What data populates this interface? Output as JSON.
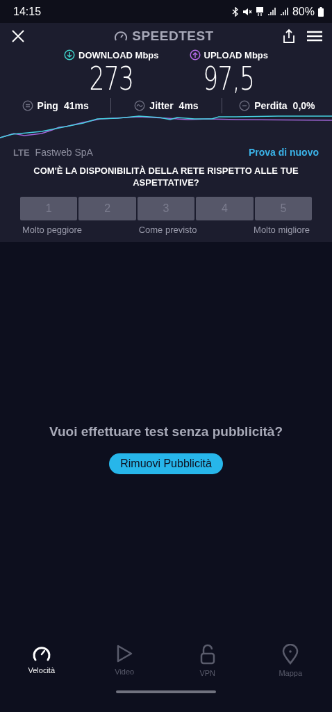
{
  "status_bar": {
    "time": "14:15",
    "battery": "80%"
  },
  "header": {
    "title": "SPEEDTEST"
  },
  "results": [
    {
      "kind": "download",
      "label": "DOWNLOAD Mbps",
      "value": "273"
    },
    {
      "kind": "upload",
      "label": "UPLOAD Mbps",
      "value": "97,5"
    }
  ],
  "metrics": [
    {
      "kind": "ping",
      "label": "Ping",
      "value": "41ms"
    },
    {
      "kind": "jitter",
      "label": "Jitter",
      "value": "4ms"
    },
    {
      "kind": "loss",
      "label": "Perdita",
      "value": "0,0%"
    }
  ],
  "network": {
    "type": "LTE",
    "provider": "Fastweb SpA",
    "retry": "Prova di nuovo"
  },
  "survey": {
    "question": "COM'È LA DISPONIBILITÀ DELLA RETE RISPETTO ALLE TUE ASPETTATIVE?",
    "options": [
      "1",
      "2",
      "3",
      "4",
      "5"
    ],
    "scale": [
      "Molto peggiore",
      "Come previsto",
      "Molto migliore"
    ]
  },
  "ad": {
    "prompt": "Vuoi effettuare test senza pubblicità?",
    "button": "Rimuovi Pubblicità"
  },
  "nav": [
    {
      "kind": "speed",
      "label": "Velocità",
      "selected": true
    },
    {
      "kind": "video",
      "label": "Video",
      "selected": false
    },
    {
      "kind": "vpn",
      "label": "VPN",
      "selected": false
    },
    {
      "kind": "map",
      "label": "Mappa",
      "selected": false
    }
  ]
}
